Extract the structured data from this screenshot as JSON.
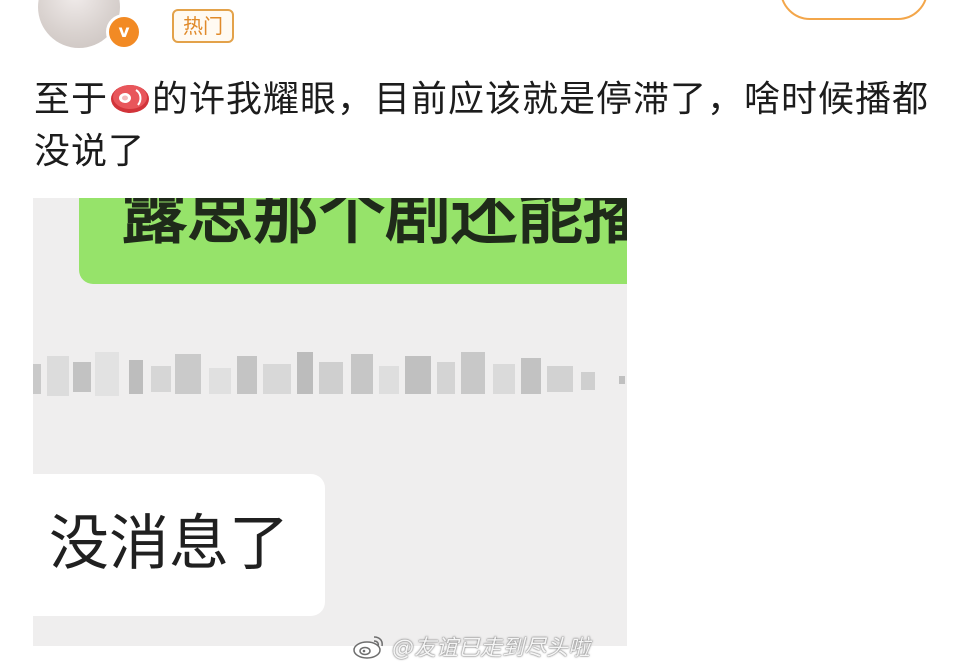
{
  "header": {
    "hot_badge": "热门",
    "verified_icon": "verified-v-icon",
    "verified_text": "v",
    "avatar_icon": "avatar-image"
  },
  "post": {
    "text_before_icon": "至于",
    "inline_icon": "steak-emoji-icon",
    "text_after_icon": "的许我耀眼，目前应该就是停滞了，啥时候播都没说了"
  },
  "screenshot": {
    "sent_message": "露思那个剧还能播吗",
    "reply_message": "没消息了"
  },
  "watermark": {
    "icon": "weibo-logo-icon",
    "text": "@友谊已走到尽头啦"
  },
  "colors": {
    "accent": "#f28a24",
    "hot_border": "#e3a24a",
    "green_bubble": "#96e36a",
    "chat_bg": "#efeeee"
  }
}
